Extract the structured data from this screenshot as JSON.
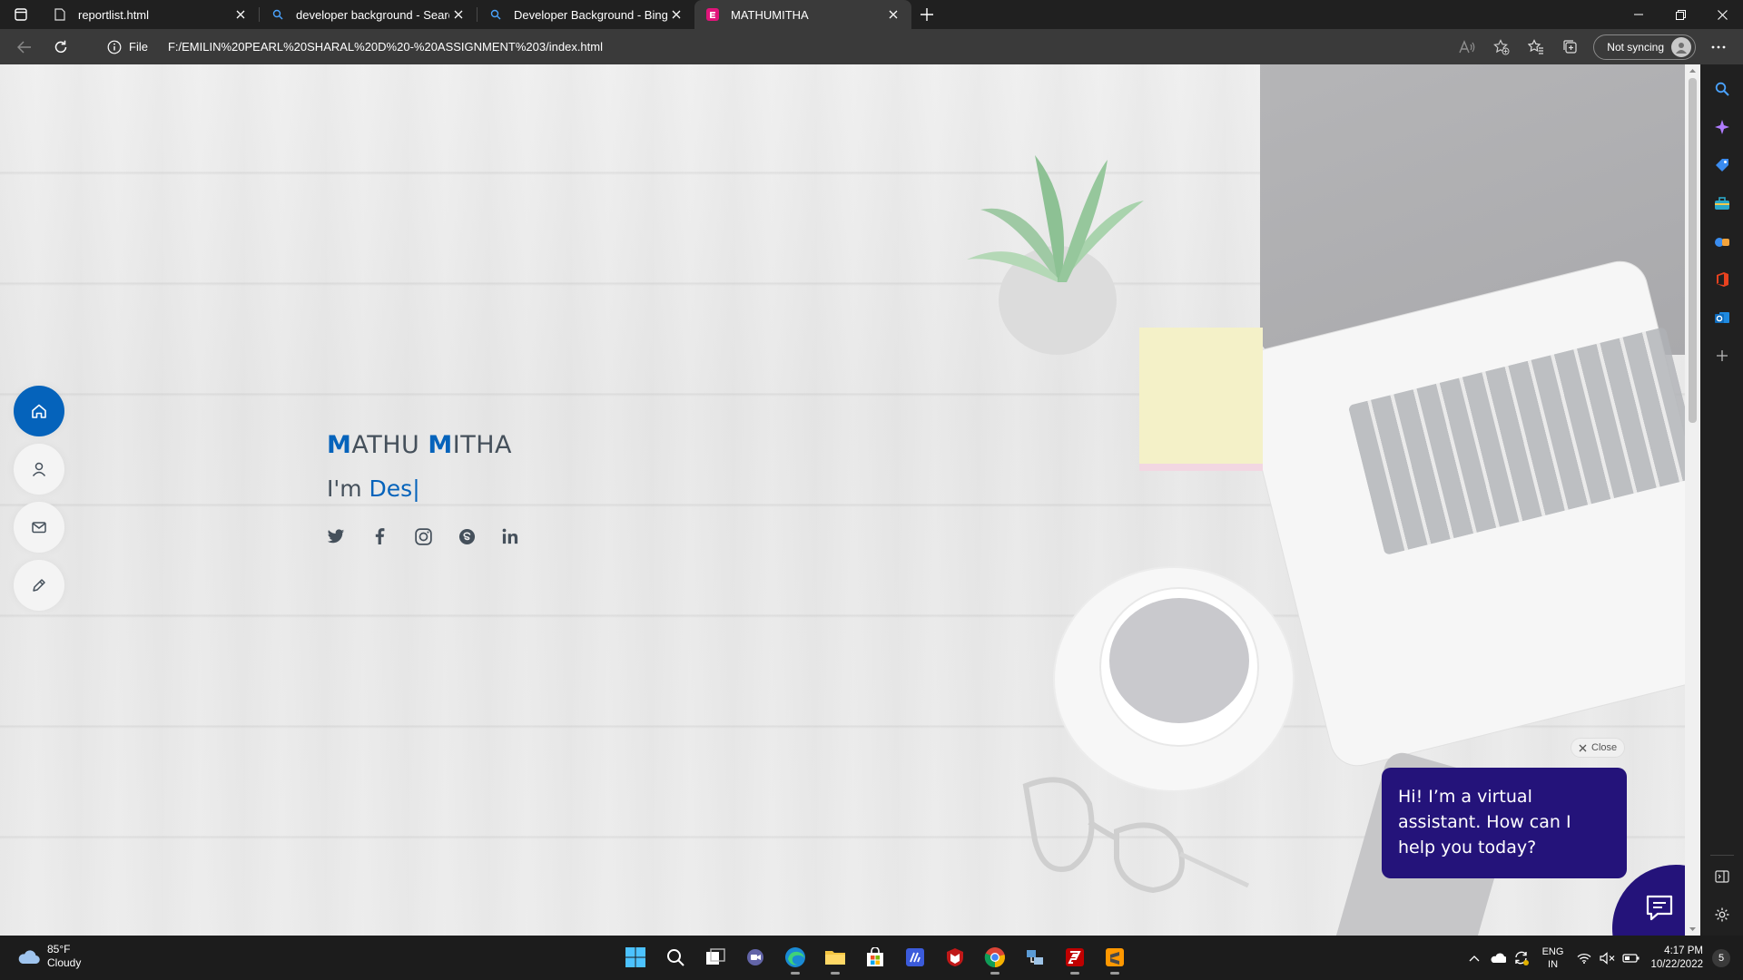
{
  "browser": {
    "tabs": [
      {
        "title": "reportlist.html",
        "icon": "page-icon",
        "active": false
      },
      {
        "title": "developer background - Search",
        "icon": "search-icon",
        "active": false
      },
      {
        "title": "Developer Background - Bing images",
        "icon": "search-icon",
        "active": false
      },
      {
        "title": "MATHUMITHA",
        "icon": "site-favicon",
        "active": true
      }
    ],
    "address": {
      "security_label": "File",
      "url": "F:/EMILIN%20PEARL%20SHARAL%20D%20-%20ASSIGNMENT%203/index.html"
    },
    "profile": {
      "sync_label": "Not syncing"
    }
  },
  "page": {
    "hero": {
      "name_first_initial": "M",
      "name_first_rest": "ATHU ",
      "name_last_initial": "M",
      "name_last_rest": "ITHA",
      "role_prefix": "I'm ",
      "role_typed": "Des|"
    },
    "nav": [
      {
        "name": "home",
        "icon": "home-icon",
        "active": true
      },
      {
        "name": "about",
        "icon": "user-icon",
        "active": false
      },
      {
        "name": "contact",
        "icon": "mail-icon",
        "active": false
      },
      {
        "name": "resume",
        "icon": "pencil-icon",
        "active": false
      }
    ],
    "social": [
      "twitter-icon",
      "facebook-icon",
      "instagram-icon",
      "skype-icon",
      "linkedin-icon"
    ],
    "chat": {
      "close_label": "Close",
      "message": "Hi! I’m a virtual assistant. How can I help you today?"
    },
    "colors": {
      "accent": "#0563bb",
      "chat": "#24137a",
      "text": "#45505b"
    }
  },
  "taskbar": {
    "weather": {
      "temp": "85°F",
      "condition": "Cloudy"
    },
    "language": {
      "line1": "ENG",
      "line2": "IN"
    },
    "clock": {
      "time": "4:17 PM",
      "date": "10/22/2022"
    },
    "notifications": "5"
  }
}
